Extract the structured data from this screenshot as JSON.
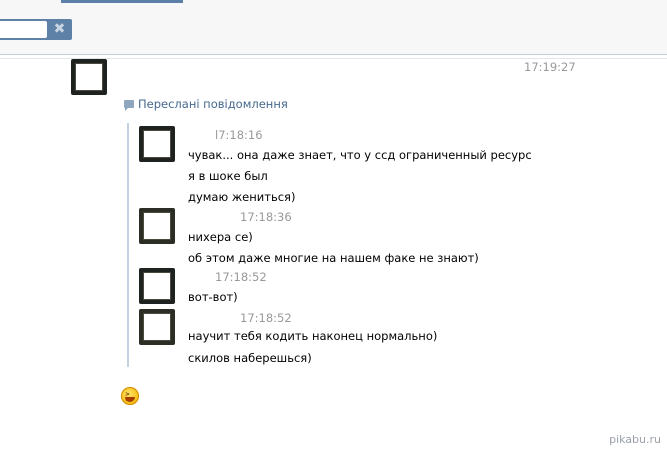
{
  "header": {
    "search_value": "",
    "clear_icon": "✖"
  },
  "dialog": {
    "main_time": "17:19:27",
    "forwarded_label": "Переслані повідомлення",
    "messages": [
      {
        "time": "l7:18:16",
        "lines": [
          "чувак... она даже знает, что у ссд ограниченный ресурс",
          "я в шоке был",
          "думаю жениться)"
        ]
      },
      {
        "time": "17:18:36",
        "lines": [
          "нихера се)",
          "об этом даже многие на нашем факе не знают)"
        ]
      },
      {
        "time": "17:18:52",
        "lines": [
          "вот-вот)"
        ]
      },
      {
        "time": "17:18:52",
        "lines": [
          "научит тебя кодить наконец нормально)",
          "скилов наберешься)"
        ]
      }
    ]
  },
  "watermark": "pikabu.ru",
  "colors": {
    "link": "#45688e",
    "time": "#999999",
    "quote_bar": "#c3d1e0",
    "search_bg": "#5e81a8"
  }
}
